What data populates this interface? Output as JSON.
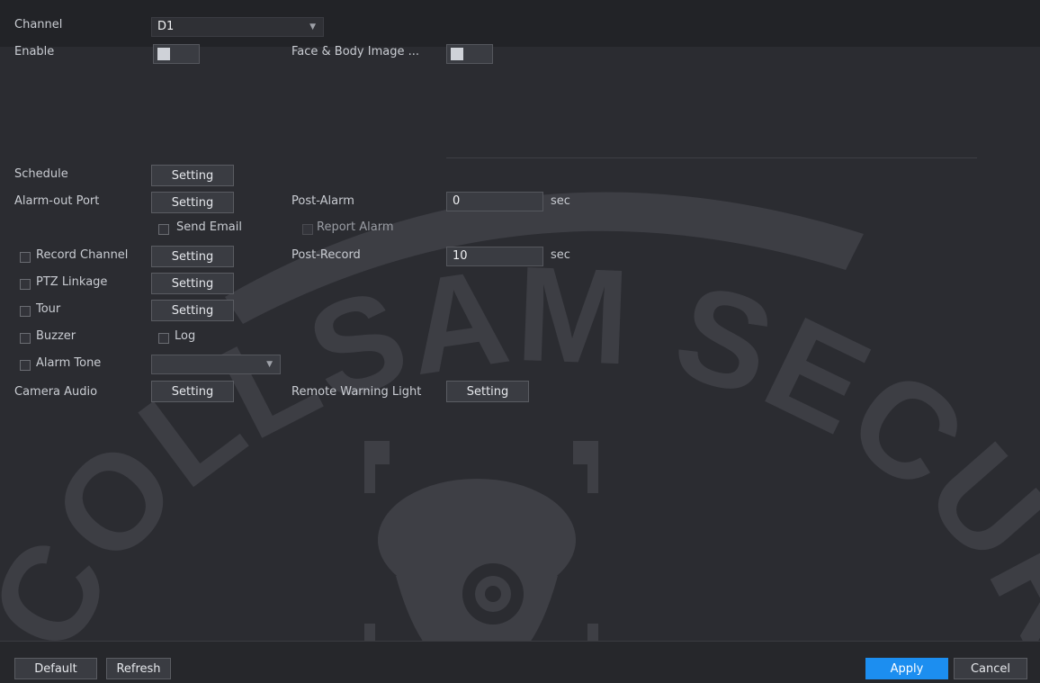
{
  "channel": {
    "label": "Channel",
    "value": "D1"
  },
  "enable": {
    "label": "Enable"
  },
  "face_body": {
    "label": "Face & Body Image ..."
  },
  "schedule": {
    "label": "Schedule",
    "button": "Setting"
  },
  "alarm_out": {
    "label": "Alarm-out Port",
    "button": "Setting"
  },
  "post_alarm": {
    "label": "Post-Alarm",
    "value": "0",
    "unit": "sec"
  },
  "send_email": {
    "label": "Send Email"
  },
  "report_alarm": {
    "label": "Report Alarm"
  },
  "record_channel": {
    "label": "Record Channel",
    "button": "Setting"
  },
  "post_record": {
    "label": "Post-Record",
    "value": "10",
    "unit": "sec"
  },
  "ptz": {
    "label": "PTZ Linkage",
    "button": "Setting"
  },
  "tour": {
    "label": "Tour",
    "button": "Setting"
  },
  "buzzer": {
    "label": "Buzzer"
  },
  "log": {
    "label": "Log"
  },
  "alarm_tone": {
    "label": "Alarm Tone",
    "value": ""
  },
  "camera_audio": {
    "label": "Camera Audio",
    "button": "Setting"
  },
  "remote_light": {
    "label": "Remote Warning Light",
    "button": "Setting"
  },
  "footer": {
    "default": "Default",
    "refresh": "Refresh",
    "apply": "Apply",
    "cancel": "Cancel"
  },
  "watermark": {
    "text": "COLLSAM SECURITY"
  },
  "colors": {
    "apply_bg": "#1c8ef0",
    "bg": "#2b2c31"
  }
}
